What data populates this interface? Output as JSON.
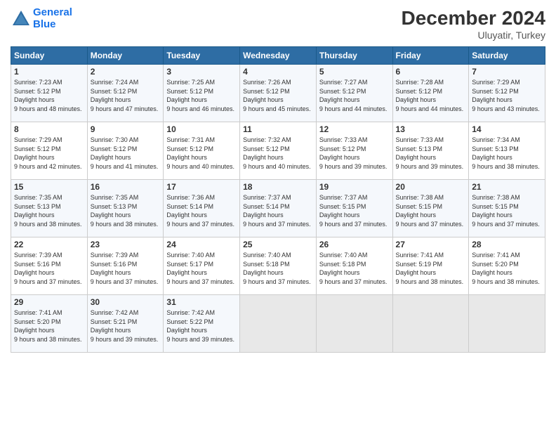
{
  "header": {
    "logo_line1": "General",
    "logo_line2": "Blue",
    "month_year": "December 2024",
    "location": "Uluyatir, Turkey"
  },
  "weekdays": [
    "Sunday",
    "Monday",
    "Tuesday",
    "Wednesday",
    "Thursday",
    "Friday",
    "Saturday"
  ],
  "weeks": [
    [
      {
        "day": "1",
        "sunrise": "7:23 AM",
        "sunset": "5:12 PM",
        "daylight": "9 hours and 48 minutes."
      },
      {
        "day": "2",
        "sunrise": "7:24 AM",
        "sunset": "5:12 PM",
        "daylight": "9 hours and 47 minutes."
      },
      {
        "day": "3",
        "sunrise": "7:25 AM",
        "sunset": "5:12 PM",
        "daylight": "9 hours and 46 minutes."
      },
      {
        "day": "4",
        "sunrise": "7:26 AM",
        "sunset": "5:12 PM",
        "daylight": "9 hours and 45 minutes."
      },
      {
        "day": "5",
        "sunrise": "7:27 AM",
        "sunset": "5:12 PM",
        "daylight": "9 hours and 44 minutes."
      },
      {
        "day": "6",
        "sunrise": "7:28 AM",
        "sunset": "5:12 PM",
        "daylight": "9 hours and 44 minutes."
      },
      {
        "day": "7",
        "sunrise": "7:29 AM",
        "sunset": "5:12 PM",
        "daylight": "9 hours and 43 minutes."
      }
    ],
    [
      {
        "day": "8",
        "sunrise": "7:29 AM",
        "sunset": "5:12 PM",
        "daylight": "9 hours and 42 minutes."
      },
      {
        "day": "9",
        "sunrise": "7:30 AM",
        "sunset": "5:12 PM",
        "daylight": "9 hours and 41 minutes."
      },
      {
        "day": "10",
        "sunrise": "7:31 AM",
        "sunset": "5:12 PM",
        "daylight": "9 hours and 40 minutes."
      },
      {
        "day": "11",
        "sunrise": "7:32 AM",
        "sunset": "5:12 PM",
        "daylight": "9 hours and 40 minutes."
      },
      {
        "day": "12",
        "sunrise": "7:33 AM",
        "sunset": "5:12 PM",
        "daylight": "9 hours and 39 minutes."
      },
      {
        "day": "13",
        "sunrise": "7:33 AM",
        "sunset": "5:13 PM",
        "daylight": "9 hours and 39 minutes."
      },
      {
        "day": "14",
        "sunrise": "7:34 AM",
        "sunset": "5:13 PM",
        "daylight": "9 hours and 38 minutes."
      }
    ],
    [
      {
        "day": "15",
        "sunrise": "7:35 AM",
        "sunset": "5:13 PM",
        "daylight": "9 hours and 38 minutes."
      },
      {
        "day": "16",
        "sunrise": "7:35 AM",
        "sunset": "5:13 PM",
        "daylight": "9 hours and 38 minutes."
      },
      {
        "day": "17",
        "sunrise": "7:36 AM",
        "sunset": "5:14 PM",
        "daylight": "9 hours and 37 minutes."
      },
      {
        "day": "18",
        "sunrise": "7:37 AM",
        "sunset": "5:14 PM",
        "daylight": "9 hours and 37 minutes."
      },
      {
        "day": "19",
        "sunrise": "7:37 AM",
        "sunset": "5:15 PM",
        "daylight": "9 hours and 37 minutes."
      },
      {
        "day": "20",
        "sunrise": "7:38 AM",
        "sunset": "5:15 PM",
        "daylight": "9 hours and 37 minutes."
      },
      {
        "day": "21",
        "sunrise": "7:38 AM",
        "sunset": "5:15 PM",
        "daylight": "9 hours and 37 minutes."
      }
    ],
    [
      {
        "day": "22",
        "sunrise": "7:39 AM",
        "sunset": "5:16 PM",
        "daylight": "9 hours and 37 minutes."
      },
      {
        "day": "23",
        "sunrise": "7:39 AM",
        "sunset": "5:16 PM",
        "daylight": "9 hours and 37 minutes."
      },
      {
        "day": "24",
        "sunrise": "7:40 AM",
        "sunset": "5:17 PM",
        "daylight": "9 hours and 37 minutes."
      },
      {
        "day": "25",
        "sunrise": "7:40 AM",
        "sunset": "5:18 PM",
        "daylight": "9 hours and 37 minutes."
      },
      {
        "day": "26",
        "sunrise": "7:40 AM",
        "sunset": "5:18 PM",
        "daylight": "9 hours and 37 minutes."
      },
      {
        "day": "27",
        "sunrise": "7:41 AM",
        "sunset": "5:19 PM",
        "daylight": "9 hours and 38 minutes."
      },
      {
        "day": "28",
        "sunrise": "7:41 AM",
        "sunset": "5:20 PM",
        "daylight": "9 hours and 38 minutes."
      }
    ],
    [
      {
        "day": "29",
        "sunrise": "7:41 AM",
        "sunset": "5:20 PM",
        "daylight": "9 hours and 38 minutes."
      },
      {
        "day": "30",
        "sunrise": "7:42 AM",
        "sunset": "5:21 PM",
        "daylight": "9 hours and 39 minutes."
      },
      {
        "day": "31",
        "sunrise": "7:42 AM",
        "sunset": "5:22 PM",
        "daylight": "9 hours and 39 minutes."
      },
      null,
      null,
      null,
      null
    ]
  ]
}
